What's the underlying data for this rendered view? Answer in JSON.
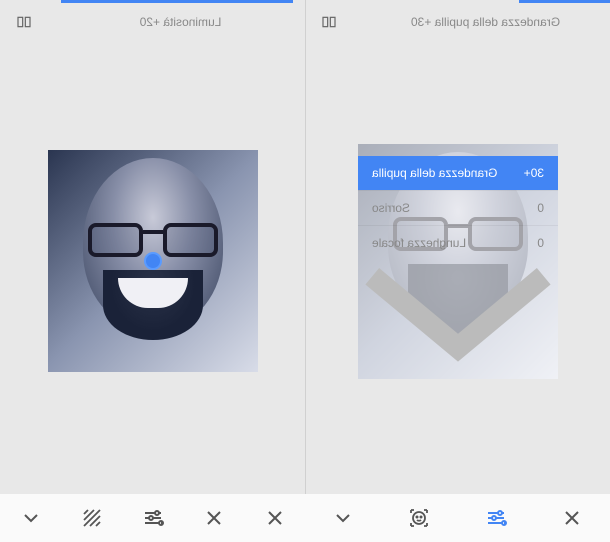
{
  "left": {
    "header": {
      "label": "Luminosità +20"
    },
    "adjustment": {
      "name": "Luminosità",
      "value": 20
    }
  },
  "right": {
    "header": {
      "label": "Grandezza della pupilla +30"
    },
    "options": [
      {
        "label": "Grandezza della pupilla",
        "value": "+30",
        "selected": true
      },
      {
        "label": "Sorriso",
        "value": "0",
        "selected": false
      },
      {
        "label": "Lunghezza focale",
        "value": "0",
        "selected": false
      }
    ]
  },
  "toolbar": {
    "left": [
      "close",
      "adjust",
      "cut",
      "texture",
      "chevron"
    ],
    "right": [
      "close",
      "tune-active",
      "face",
      "close2",
      "chevron"
    ]
  },
  "colors": {
    "accent": "#4285f4"
  }
}
